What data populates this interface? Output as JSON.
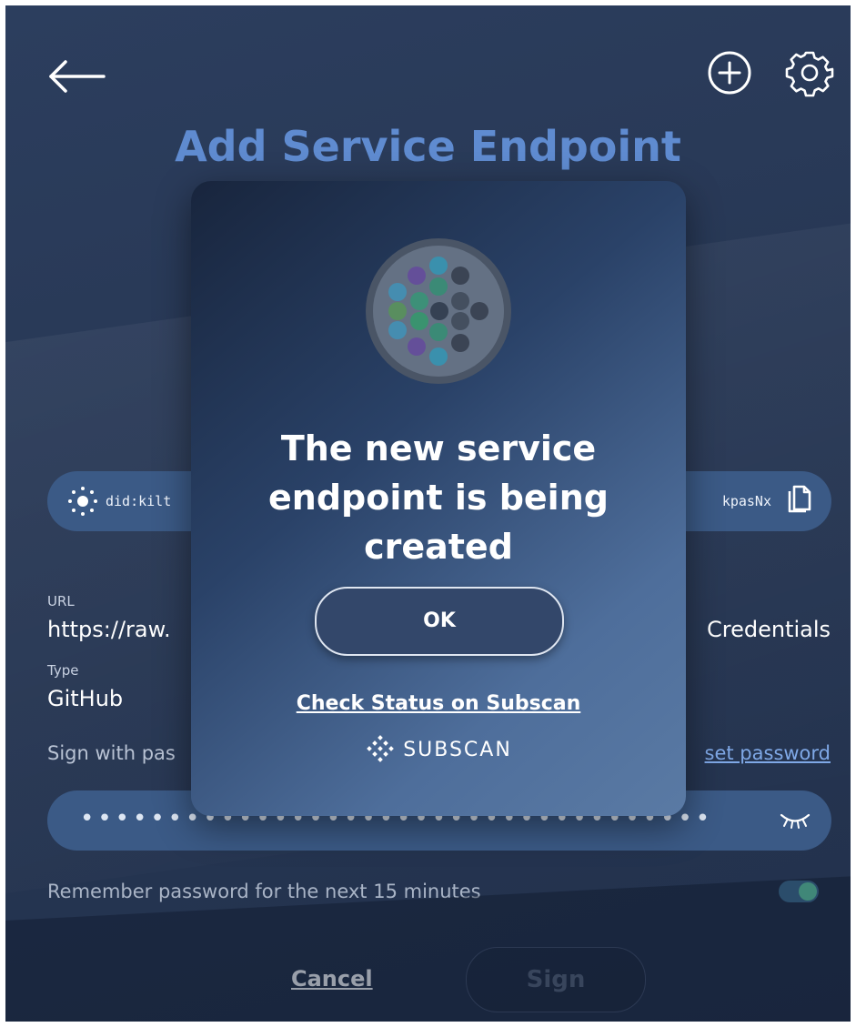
{
  "header": {
    "title": "Add Service Endpoint"
  },
  "did": {
    "prefix": "did:kilt",
    "suffix": "kpasNx"
  },
  "fields": {
    "url_label": "URL",
    "url_value_start": "https://raw.",
    "url_value_end": "Credentials",
    "type_label": "Type",
    "type_value": "GitHub"
  },
  "password": {
    "sign_label": "Sign with pas",
    "forgot_label": "set password",
    "masked_value": "••••••••••••••••••••••••••••••••••••",
    "remember_label": "Remember password for the next 15 minutes",
    "remember_enabled": true
  },
  "actions": {
    "cancel_label": "Cancel",
    "sign_label": "Sign"
  },
  "modal": {
    "message": "The new service endpoint is being created",
    "ok_label": "OK",
    "subscan_link": "Check Status on Subscan",
    "subscan_logo_text": "SUBSCAN"
  },
  "icons": {
    "back": "arrow-left-icon",
    "add": "plus-circle-icon",
    "settings": "gear-icon",
    "did": "sparkle-icon",
    "copy": "copy-icon",
    "eye": "eye-closed-icon",
    "subscan": "subscan-logo-icon",
    "spinner": "loading-spinner-icon"
  },
  "colors": {
    "title": "#5f8bd0",
    "pill": "#3b5a86",
    "toggle_knob": "#5fc6a6",
    "link": "#7fa8e6"
  }
}
